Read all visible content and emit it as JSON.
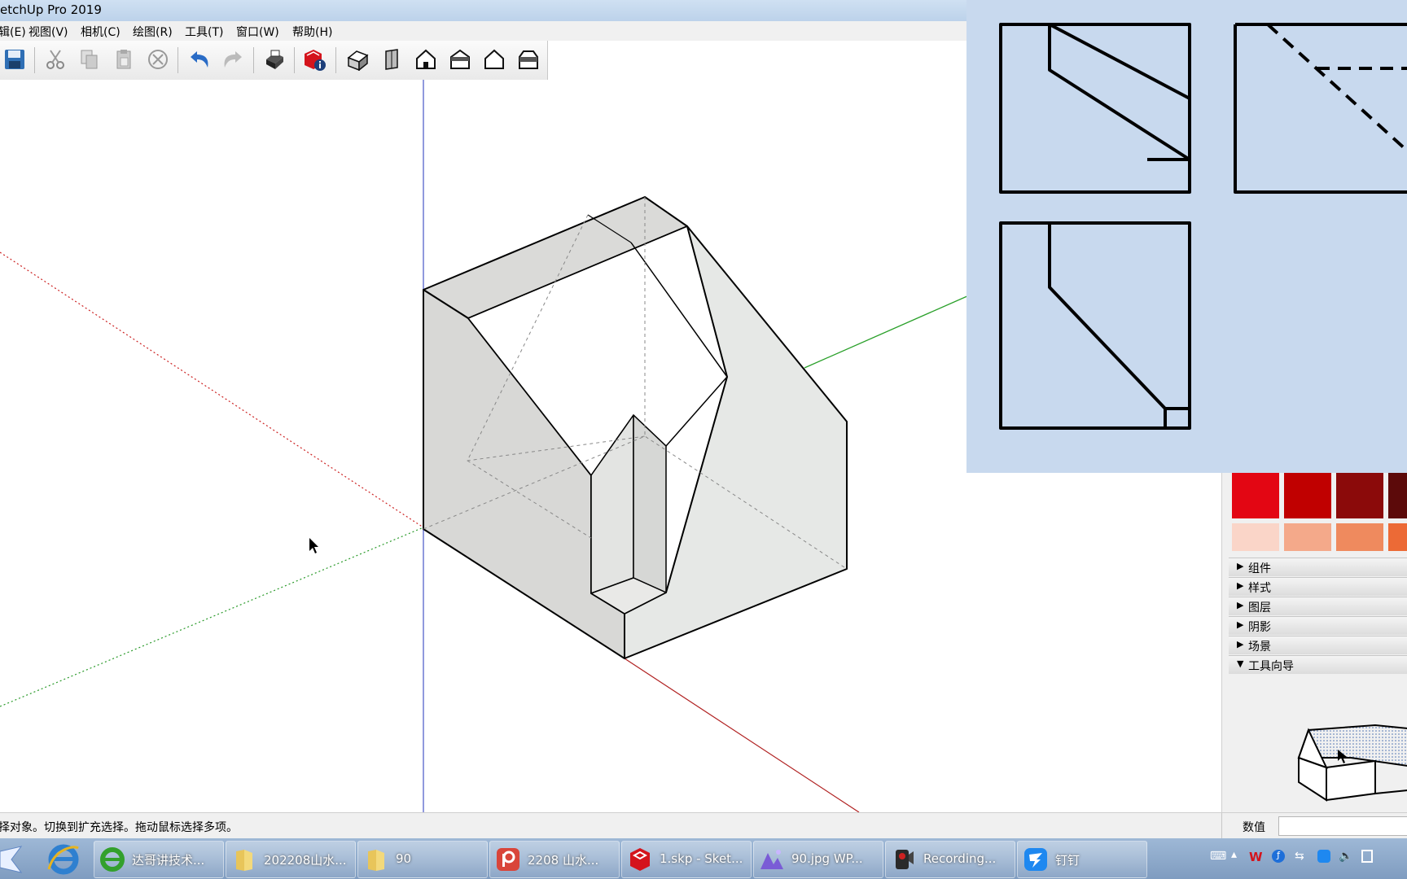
{
  "window": {
    "title": "etchUp Pro 2019"
  },
  "menu": [
    "编辑(E)",
    "视图(V)",
    "相机(C)",
    "绘图(R)",
    "工具(T)",
    "窗口(W)",
    "帮助(H)"
  ],
  "toolbar": {
    "icons": [
      "save-icon",
      "cut-icon",
      "copy-icon",
      "paste-icon",
      "erase-icon",
      "undo-icon",
      "redo-icon",
      "print-icon",
      "model-info-icon",
      "iso-view-icon",
      "top-view-icon",
      "front-view-icon",
      "right-view-icon",
      "back-view-icon",
      "left-view-icon"
    ]
  },
  "right_panel": {
    "colors": {
      "row1": [
        "#e30613",
        "#c00000",
        "#8b0a0a",
        "#5c0a0a"
      ],
      "row2": [
        "#fad5c8",
        "#f4a98a",
        "#ef8a5e",
        "#ec6a36"
      ]
    },
    "trays": [
      {
        "label": "组件",
        "state": "collapsed"
      },
      {
        "label": "样式",
        "state": "collapsed"
      },
      {
        "label": "图层",
        "state": "collapsed"
      },
      {
        "label": "阴影",
        "state": "collapsed"
      },
      {
        "label": "场景",
        "state": "collapsed"
      },
      {
        "label": "工具向导",
        "state": "expanded"
      }
    ]
  },
  "status": {
    "message": "选择对象。切换到扩充选择。拖动鼠标选择多项。",
    "measure_label": "数值",
    "measure_value": ""
  },
  "taskbar": {
    "tasks": [
      {
        "label": "达哥讲技术...",
        "icon": "ie-icon"
      },
      {
        "label": "202208山水...",
        "icon": "folder-icon"
      },
      {
        "label": "90",
        "icon": "folder-icon"
      },
      {
        "label": "2208 山水...",
        "icon": "presentation-icon"
      },
      {
        "label": "1.skp - Sket...",
        "icon": "sketchup-icon"
      },
      {
        "label": "90.jpg  WP...",
        "icon": "image-viewer-icon"
      },
      {
        "label": "Recording...",
        "icon": "camera-icon"
      },
      {
        "label": "钉钉",
        "icon": "dingtalk-icon"
      }
    ]
  },
  "colors": {
    "accent": "#2a6cc6",
    "overlay_bg": "#c8d9ee",
    "taskbar": "#8ba8cb"
  }
}
